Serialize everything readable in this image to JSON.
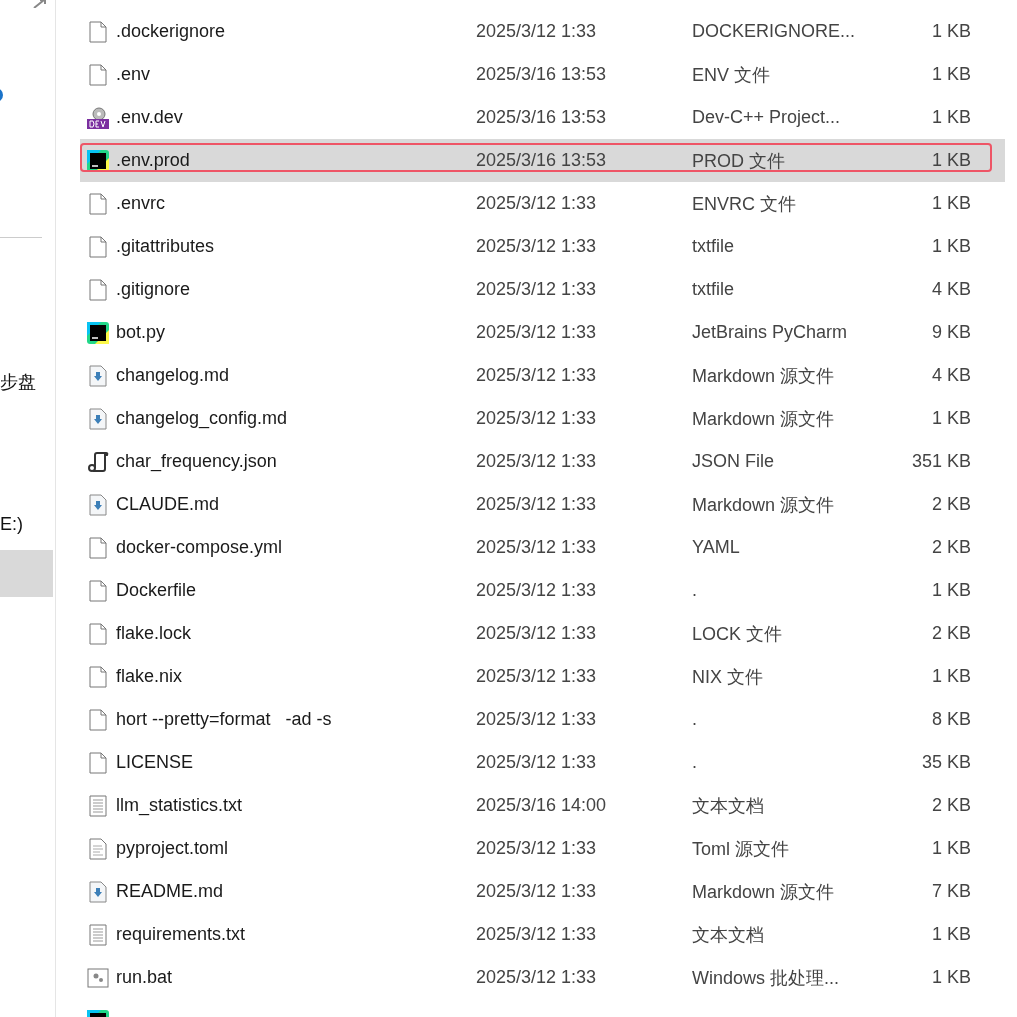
{
  "sidebar": {
    "items": [
      {
        "label": "步盘",
        "selected": false
      },
      {
        "label": "E:)",
        "selected": false
      },
      {
        "selected": true
      }
    ]
  },
  "files": [
    {
      "kind": "file",
      "name": ".dockerignore",
      "date": "2025/3/12 1:33",
      "type": "DOCKERIGNORE...",
      "size": "1 KB",
      "selected": false
    },
    {
      "kind": "file",
      "name": ".env",
      "date": "2025/3/16 13:53",
      "type": "ENV 文件",
      "size": "1 KB",
      "selected": false
    },
    {
      "kind": "dev",
      "name": ".env.dev",
      "date": "2025/3/16 13:53",
      "type": "Dev-C++ Project...",
      "size": "1 KB",
      "selected": false
    },
    {
      "kind": "pycharm",
      "name": ".env.prod",
      "date": "2025/3/16 13:53",
      "type": "PROD 文件",
      "size": "1 KB",
      "selected": true
    },
    {
      "kind": "file",
      "name": ".envrc",
      "date": "2025/3/12 1:33",
      "type": "ENVRC 文件",
      "size": "1 KB",
      "selected": false
    },
    {
      "kind": "file",
      "name": ".gitattributes",
      "date": "2025/3/12 1:33",
      "type": "txtfile",
      "size": "1 KB",
      "selected": false
    },
    {
      "kind": "file",
      "name": ".gitignore",
      "date": "2025/3/12 1:33",
      "type": "txtfile",
      "size": "4 KB",
      "selected": false
    },
    {
      "kind": "pycharm",
      "name": "bot.py",
      "date": "2025/3/12 1:33",
      "type": "JetBrains PyCharm",
      "size": "9 KB",
      "selected": false
    },
    {
      "kind": "markdown",
      "name": "changelog.md",
      "date": "2025/3/12 1:33",
      "type": "Markdown 源文件",
      "size": "4 KB",
      "selected": false
    },
    {
      "kind": "markdown",
      "name": "changelog_config.md",
      "date": "2025/3/12 1:33",
      "type": "Markdown 源文件",
      "size": "1 KB",
      "selected": false
    },
    {
      "kind": "json",
      "name": "char_frequency.json",
      "date": "2025/3/12 1:33",
      "type": "JSON File",
      "size": "351 KB",
      "selected": false
    },
    {
      "kind": "markdown",
      "name": "CLAUDE.md",
      "date": "2025/3/12 1:33",
      "type": "Markdown 源文件",
      "size": "2 KB",
      "selected": false
    },
    {
      "kind": "file",
      "name": "docker-compose.yml",
      "date": "2025/3/12 1:33",
      "type": "YAML",
      "size": "2 KB",
      "selected": false
    },
    {
      "kind": "file",
      "name": "Dockerfile",
      "date": "2025/3/12 1:33",
      "type": ".",
      "size": "1 KB",
      "selected": false
    },
    {
      "kind": "file",
      "name": "flake.lock",
      "date": "2025/3/12 1:33",
      "type": "LOCK 文件",
      "size": "2 KB",
      "selected": false
    },
    {
      "kind": "file",
      "name": "flake.nix",
      "date": "2025/3/12 1:33",
      "type": "NIX 文件",
      "size": "1 KB",
      "selected": false
    },
    {
      "kind": "file",
      "name": "hort --pretty=format   -ad -s",
      "date": "2025/3/12 1:33",
      "type": ".",
      "size": "8 KB",
      "selected": false
    },
    {
      "kind": "file",
      "name": "LICENSE",
      "date": "2025/3/12 1:33",
      "type": ".",
      "size": "35 KB",
      "selected": false
    },
    {
      "kind": "text",
      "name": "llm_statistics.txt",
      "date": "2025/3/16 14:00",
      "type": "文本文档",
      "size": "2 KB",
      "selected": false
    },
    {
      "kind": "config",
      "name": "pyproject.toml",
      "date": "2025/3/12 1:33",
      "type": "Toml 源文件",
      "size": "1 KB",
      "selected": false
    },
    {
      "kind": "markdown",
      "name": "README.md",
      "date": "2025/3/12 1:33",
      "type": "Markdown 源文件",
      "size": "7 KB",
      "selected": false
    },
    {
      "kind": "text",
      "name": "requirements.txt",
      "date": "2025/3/12 1:33",
      "type": "文本文档",
      "size": "1 KB",
      "selected": false
    },
    {
      "kind": "bat",
      "name": "run.bat",
      "date": "2025/3/12 1:33",
      "type": "Windows 批处理...",
      "size": "1 KB",
      "selected": false
    },
    {
      "kind": "pycharm",
      "selected": false
    }
  ]
}
